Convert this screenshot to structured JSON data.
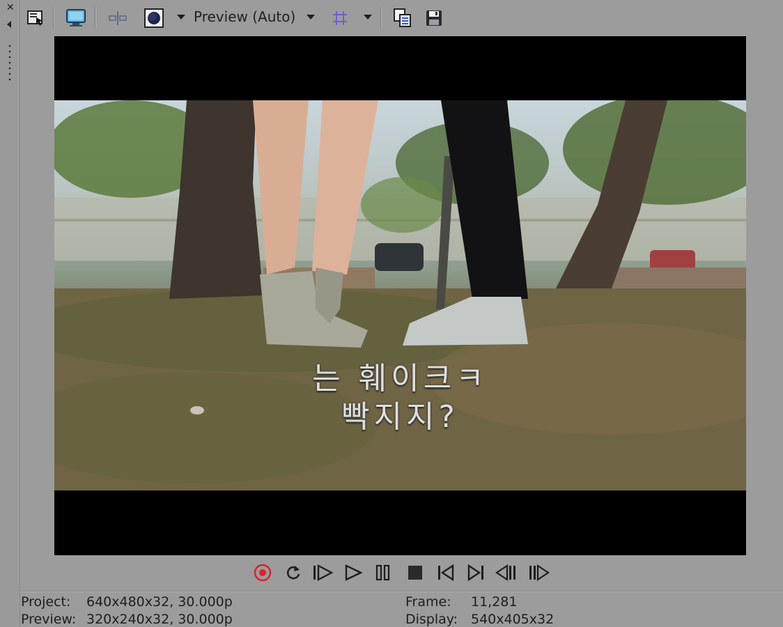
{
  "toolbar": {
    "preview_quality_label": "Preview (Auto)",
    "icons": [
      "video-preview-properties-icon",
      "external-monitor-icon",
      "split-screen-icon",
      "channel-overlay-icon",
      "grid-overlay-icon",
      "copy-snapshot-icon",
      "save-snapshot-icon"
    ]
  },
  "video": {
    "subtitle_line1": "는 훼이크ㅋ",
    "subtitle_line2": "빡지지?"
  },
  "transport": {
    "icons": [
      "record-icon",
      "loop-icon",
      "play-from-start-icon",
      "play-icon",
      "pause-icon",
      "stop-icon",
      "prev-frame-icon",
      "next-frame-icon",
      "prev-event-icon",
      "next-event-icon"
    ]
  },
  "status": {
    "project_label": "Project:",
    "project_value": "640x480x32, 30.000p",
    "preview_label": "Preview:",
    "preview_value": "320x240x32, 30.000p",
    "frame_label": "Frame:",
    "frame_value": "11,281",
    "display_label": "Display:",
    "display_value": "540x405x32"
  },
  "colors": {
    "panel_bg": "#9c9c9c",
    "record_accent": "#d9232d",
    "grid_accent": "#6a5fd4"
  }
}
